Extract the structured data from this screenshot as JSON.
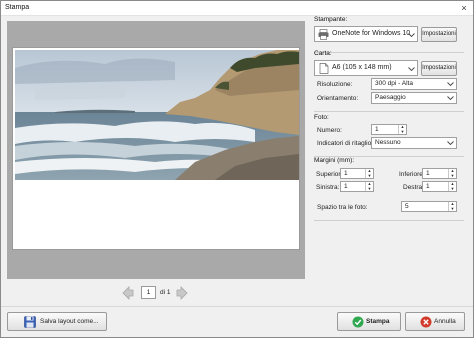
{
  "window": {
    "title": "Stampa",
    "close_glyph": "×"
  },
  "printer": {
    "section_label": "Stampante:",
    "selected": "OneNote for Windows 10",
    "settings_button": "Impostazioni"
  },
  "paper": {
    "section_label": "Carta:",
    "selected": "A6 (105 x 148 mm)",
    "settings_button": "Impostazioni",
    "resolution_label": "Risoluzione:",
    "resolution_value": "300 dpi - Alta",
    "orientation_label": "Orientamento:",
    "orientation_value": "Paesaggio"
  },
  "photo": {
    "section_label": "Foto:",
    "number_label": "Numero:",
    "number_value": "1",
    "crop_label": "Indicatori di ritaglio:",
    "crop_value": "Nessuno"
  },
  "margins": {
    "section_label": "Margini (mm):",
    "top_label": "Superiore:",
    "top_value": "1",
    "bottom_label": "Inferiore:",
    "bottom_value": "1",
    "left_label": "Sinistra:",
    "left_value": "1",
    "right_label": "Destra:",
    "right_value": "1",
    "spacing_label": "Spazio tra le foto:",
    "spacing_value": "5"
  },
  "pager": {
    "current_page": "1",
    "total_text": "di 1"
  },
  "buttons": {
    "save_layout": "Salva layout come...",
    "print": "Stampa",
    "cancel": "Annulla"
  },
  "icons": {
    "printer": "printer-icon",
    "paper": "paper-icon",
    "save": "floppy-disk-icon",
    "print": "green-check-icon",
    "cancel": "red-cancel-icon",
    "prev": "arrow-left-icon",
    "next": "arrow-right-icon"
  },
  "colors": {
    "preview_background": "#a9a9a9",
    "print_icon": "#2fa84f",
    "cancel_icon": "#d23a2a"
  }
}
